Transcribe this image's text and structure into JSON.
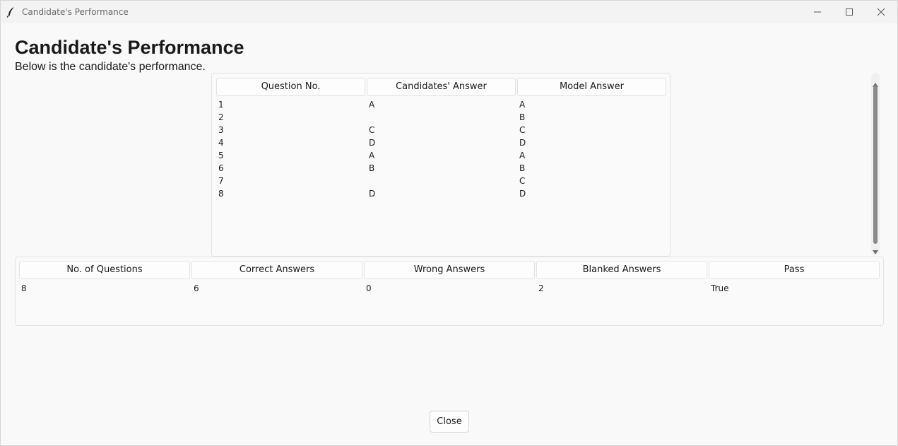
{
  "window": {
    "title": "Candidate's Performance"
  },
  "page": {
    "heading": "Candidate's Performance",
    "subheading": "Below is the candidate's performance."
  },
  "answers_table": {
    "headers": [
      "Question No.",
      "Candidates' Answer",
      "Model Answer"
    ],
    "rows": [
      [
        "1",
        "A",
        "A"
      ],
      [
        "2",
        "",
        "B"
      ],
      [
        "3",
        "C",
        "C"
      ],
      [
        "4",
        "D",
        "D"
      ],
      [
        "5",
        "A",
        "A"
      ],
      [
        "6",
        "B",
        "B"
      ],
      [
        "7",
        "",
        "C"
      ],
      [
        "8",
        "D",
        "D"
      ]
    ]
  },
  "summary_table": {
    "headers": [
      "No. of Questions",
      "Correct Answers",
      "Wrong Answers",
      "Blanked Answers",
      "Pass"
    ],
    "rows": [
      [
        "8",
        "6",
        "0",
        "2",
        "True"
      ]
    ]
  },
  "footer": {
    "close_label": "Close"
  },
  "icons": {
    "app": "feather-icon",
    "minimize": "minimize-icon",
    "maximize": "maximize-icon",
    "close": "close-icon"
  }
}
